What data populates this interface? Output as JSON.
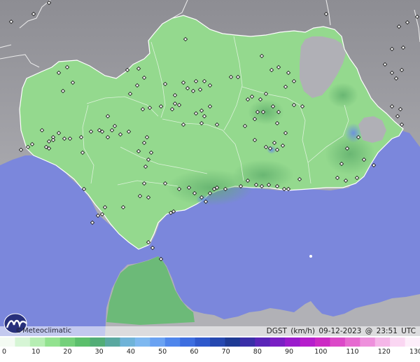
{
  "brand": {
    "copyright": "©",
    "name": "Meteoclimatic"
  },
  "meta": {
    "variable": "DGST",
    "unit": "(km/h)",
    "date": "09-12-2023",
    "at": "@",
    "time": "23:51",
    "tz": "UTC"
  },
  "legend": {
    "ticks": [
      "0",
      "10",
      "20",
      "30",
      "40",
      "50",
      "60",
      "70",
      "80",
      "90",
      "100",
      "110",
      "120",
      "130"
    ],
    "colors": [
      "#f4fbf3",
      "#d6f5d5",
      "#b6eeb3",
      "#92e28f",
      "#74d07a",
      "#5cbf6c",
      "#52ad76",
      "#5aa8a0",
      "#6fb3d8",
      "#7eb8f0",
      "#6aa2f2",
      "#4f86ec",
      "#3d6ee0",
      "#2f59cc",
      "#2648b0",
      "#1e3a94",
      "#3a2fa8",
      "#5a25b8",
      "#7a1fc4",
      "#9a1bcc",
      "#b61ecc",
      "#cc2ac4",
      "#dc48c8",
      "#e66ad0",
      "#ee90dc",
      "#f5b6e8",
      "#fad6f2",
      "#fdeefa"
    ]
  },
  "colors": {
    "sea": "#7b87dc",
    "land_grey": "#a8a8ad",
    "region_green": "#94d98e",
    "morocco_green": "#6cba78"
  },
  "stations": [
    [
      16,
      31
    ],
    [
      48,
      20
    ],
    [
      70,
      4
    ],
    [
      84,
      104
    ],
    [
      96,
      96
    ],
    [
      104,
      118
    ],
    [
      90,
      130
    ],
    [
      182,
      100
    ],
    [
      198,
      98
    ],
    [
      206,
      111
    ],
    [
      196,
      122
    ],
    [
      186,
      134
    ],
    [
      265,
      56
    ],
    [
      236,
      120
    ],
    [
      262,
      118
    ],
    [
      268,
      126
    ],
    [
      276,
      130
    ],
    [
      250,
      136
    ],
    [
      250,
      148
    ],
    [
      256,
      150
    ],
    [
      286,
      128
    ],
    [
      292,
      116
    ],
    [
      280,
      116
    ],
    [
      300,
      122
    ],
    [
      330,
      110
    ],
    [
      340,
      110
    ],
    [
      374,
      80
    ],
    [
      388,
      100
    ],
    [
      398,
      96
    ],
    [
      412,
      104
    ],
    [
      420,
      116
    ],
    [
      408,
      124
    ],
    [
      380,
      134
    ],
    [
      360,
      138
    ],
    [
      354,
      142
    ],
    [
      372,
      142
    ],
    [
      368,
      160
    ],
    [
      376,
      160
    ],
    [
      390,
      152
    ],
    [
      364,
      170
    ],
    [
      420,
      150
    ],
    [
      432,
      152
    ],
    [
      398,
      160
    ],
    [
      396,
      176
    ],
    [
      408,
      190
    ],
    [
      392,
      204
    ],
    [
      386,
      212
    ],
    [
      380,
      210
    ],
    [
      396,
      214
    ],
    [
      404,
      208
    ],
    [
      364,
      200
    ],
    [
      350,
      180
    ],
    [
      310,
      178
    ],
    [
      300,
      152
    ],
    [
      288,
      158
    ],
    [
      280,
      162
    ],
    [
      292,
      166
    ],
    [
      288,
      176
    ],
    [
      262,
      178
    ],
    [
      246,
      156
    ],
    [
      230,
      152
    ],
    [
      214,
      154
    ],
    [
      204,
      156
    ],
    [
      154,
      166
    ],
    [
      146,
      188
    ],
    [
      142,
      186
    ],
    [
      160,
      186
    ],
    [
      164,
      180
    ],
    [
      172,
      192
    ],
    [
      154,
      196
    ],
    [
      130,
      188
    ],
    [
      100,
      198
    ],
    [
      92,
      198
    ],
    [
      84,
      190
    ],
    [
      76,
      196
    ],
    [
      70,
      202
    ],
    [
      66,
      210
    ],
    [
      70,
      212
    ],
    [
      76,
      200
    ],
    [
      60,
      186
    ],
    [
      46,
      206
    ],
    [
      40,
      210
    ],
    [
      30,
      214
    ],
    [
      118,
      218
    ],
    [
      116,
      196
    ],
    [
      184,
      188
    ],
    [
      210,
      196
    ],
    [
      206,
      204
    ],
    [
      198,
      216
    ],
    [
      216,
      218
    ],
    [
      212,
      228
    ],
    [
      208,
      238
    ],
    [
      206,
      262
    ],
    [
      200,
      280
    ],
    [
      212,
      282
    ],
    [
      236,
      262
    ],
    [
      270,
      268
    ],
    [
      278,
      276
    ],
    [
      288,
      282
    ],
    [
      294,
      288
    ],
    [
      300,
      276
    ],
    [
      306,
      270
    ],
    [
      310,
      268
    ],
    [
      322,
      270
    ],
    [
      344,
      266
    ],
    [
      354,
      258
    ],
    [
      366,
      264
    ],
    [
      374,
      266
    ],
    [
      384,
      264
    ],
    [
      396,
      266
    ],
    [
      406,
      270
    ],
    [
      412,
      270
    ],
    [
      428,
      256
    ],
    [
      482,
      254
    ],
    [
      494,
      258
    ],
    [
      510,
      254
    ],
    [
      520,
      228
    ],
    [
      512,
      196
    ],
    [
      496,
      212
    ],
    [
      488,
      234
    ],
    [
      534,
      236
    ],
    [
      560,
      152
    ],
    [
      572,
      156
    ],
    [
      568,
      166
    ],
    [
      574,
      178
    ],
    [
      550,
      92
    ],
    [
      560,
      104
    ],
    [
      566,
      112
    ],
    [
      574,
      100
    ],
    [
      560,
      70
    ],
    [
      576,
      68
    ],
    [
      570,
      38
    ],
    [
      582,
      32
    ],
    [
      596,
      24
    ],
    [
      466,
      20
    ],
    [
      120,
      270
    ],
    [
      146,
      306
    ],
    [
      140,
      308
    ],
    [
      132,
      318
    ],
    [
      150,
      296
    ],
    [
      176,
      296
    ],
    [
      212,
      346
    ],
    [
      218,
      354
    ],
    [
      230,
      370
    ],
    [
      256,
      270
    ],
    [
      248,
      302
    ],
    [
      244,
      304
    ]
  ]
}
